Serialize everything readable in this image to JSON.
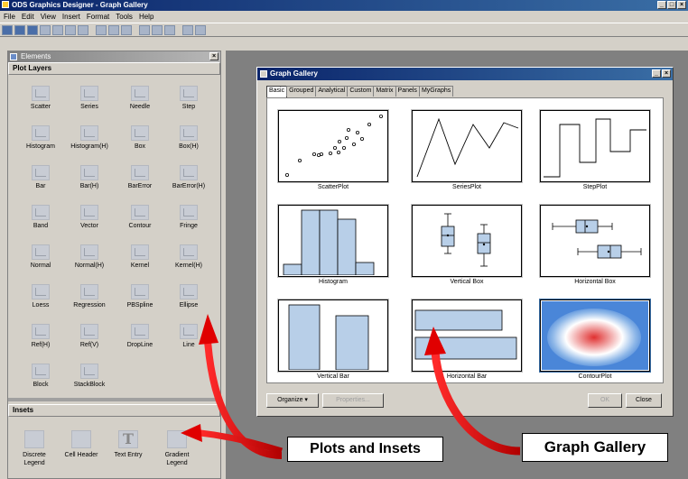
{
  "app": {
    "title": "ODS Graphics Designer - Graph Gallery",
    "menu": [
      "File",
      "Edit",
      "View",
      "Insert",
      "Format",
      "Tools",
      "Help"
    ],
    "window_buttons": [
      "_",
      "□",
      "×"
    ]
  },
  "elements_panel": {
    "title": "Elements",
    "close_label": "×",
    "plot_layers_header": "Plot Layers",
    "plot_layers": [
      {
        "label": "Scatter",
        "icon": "scatter-icon"
      },
      {
        "label": "Series",
        "icon": "series-icon"
      },
      {
        "label": "Needle",
        "icon": "needle-icon"
      },
      {
        "label": "Step",
        "icon": "step-icon"
      },
      {
        "label": "Histogram",
        "icon": "histogram-icon"
      },
      {
        "label": "Histogram(H)",
        "icon": "histogram-h-icon"
      },
      {
        "label": "Box",
        "icon": "box-icon"
      },
      {
        "label": "Box(H)",
        "icon": "box-h-icon"
      },
      {
        "label": "Bar",
        "icon": "bar-icon"
      },
      {
        "label": "Bar(H)",
        "icon": "bar-h-icon"
      },
      {
        "label": "BarError",
        "icon": "bar-error-icon"
      },
      {
        "label": "BarError(H)",
        "icon": "bar-error-h-icon"
      },
      {
        "label": "Band",
        "icon": "band-icon"
      },
      {
        "label": "Vector",
        "icon": "vector-icon"
      },
      {
        "label": "Contour",
        "icon": "contour-icon"
      },
      {
        "label": "Fringe",
        "icon": "fringe-icon"
      },
      {
        "label": "Normal",
        "icon": "normal-icon"
      },
      {
        "label": "Normal(H)",
        "icon": "normal-h-icon"
      },
      {
        "label": "Kernel",
        "icon": "kernel-icon"
      },
      {
        "label": "Kernel(H)",
        "icon": "kernel-h-icon"
      },
      {
        "label": "Loess",
        "icon": "loess-icon"
      },
      {
        "label": "Regression",
        "icon": "regression-icon"
      },
      {
        "label": "PBSpline",
        "icon": "pbspline-icon"
      },
      {
        "label": "Ellipse",
        "icon": "ellipse-icon"
      },
      {
        "label": "Ref(H)",
        "icon": "ref-h-icon"
      },
      {
        "label": "Ref(V)",
        "icon": "ref-v-icon"
      },
      {
        "label": "DropLine",
        "icon": "dropline-icon"
      },
      {
        "label": "Line",
        "icon": "line-icon"
      },
      {
        "label": "Block",
        "icon": "block-icon"
      },
      {
        "label": "StackBlock",
        "icon": "stackblock-icon"
      }
    ],
    "insets_header": "Insets",
    "insets": [
      {
        "label": "Discrete Legend",
        "icon": "discrete-legend-icon",
        "glyph": ""
      },
      {
        "label": "Cell Header",
        "icon": "cell-header-icon",
        "glyph": ""
      },
      {
        "label": "Text Entry",
        "icon": "text-entry-icon",
        "glyph": "T"
      },
      {
        "label": "Gradient Legend",
        "icon": "gradient-legend-icon",
        "glyph": ""
      }
    ]
  },
  "gallery": {
    "title": "Graph Gallery",
    "window_buttons": [
      "_",
      "×"
    ],
    "tabs": [
      "Basic",
      "Grouped",
      "Analytical",
      "Custom",
      "Matrix",
      "Panels",
      "MyGraphs"
    ],
    "active_tab": "Basic",
    "thumbnails": [
      {
        "label": "ScatterPlot",
        "icon": "scatter-plot-thumbnail"
      },
      {
        "label": "SeriesPlot",
        "icon": "series-plot-thumbnail"
      },
      {
        "label": "StepPlot",
        "icon": "step-plot-thumbnail"
      },
      {
        "label": "Histogram",
        "icon": "histogram-thumbnail"
      },
      {
        "label": "Vertical Box",
        "icon": "vertical-box-thumbnail"
      },
      {
        "label": "Horizontal Box",
        "icon": "horizontal-box-thumbnail"
      },
      {
        "label": "Vertical Bar",
        "icon": "vertical-bar-thumbnail"
      },
      {
        "label": "Horizontal Bar",
        "icon": "horizontal-bar-thumbnail"
      },
      {
        "label": "ContourPlot",
        "icon": "contour-plot-thumbnail"
      }
    ],
    "organize_label": "Organize",
    "properties_label": "Properties...",
    "ok_label": "OK",
    "close_label": "Close"
  },
  "annotations": {
    "plots_and_insets": "Plots and Insets",
    "graph_gallery": "Graph Gallery"
  },
  "colors": {
    "title_bar": "#0a246a",
    "bar_fill": "#b8cfe8",
    "arrow": "#e00000",
    "workspace": "#808080"
  }
}
